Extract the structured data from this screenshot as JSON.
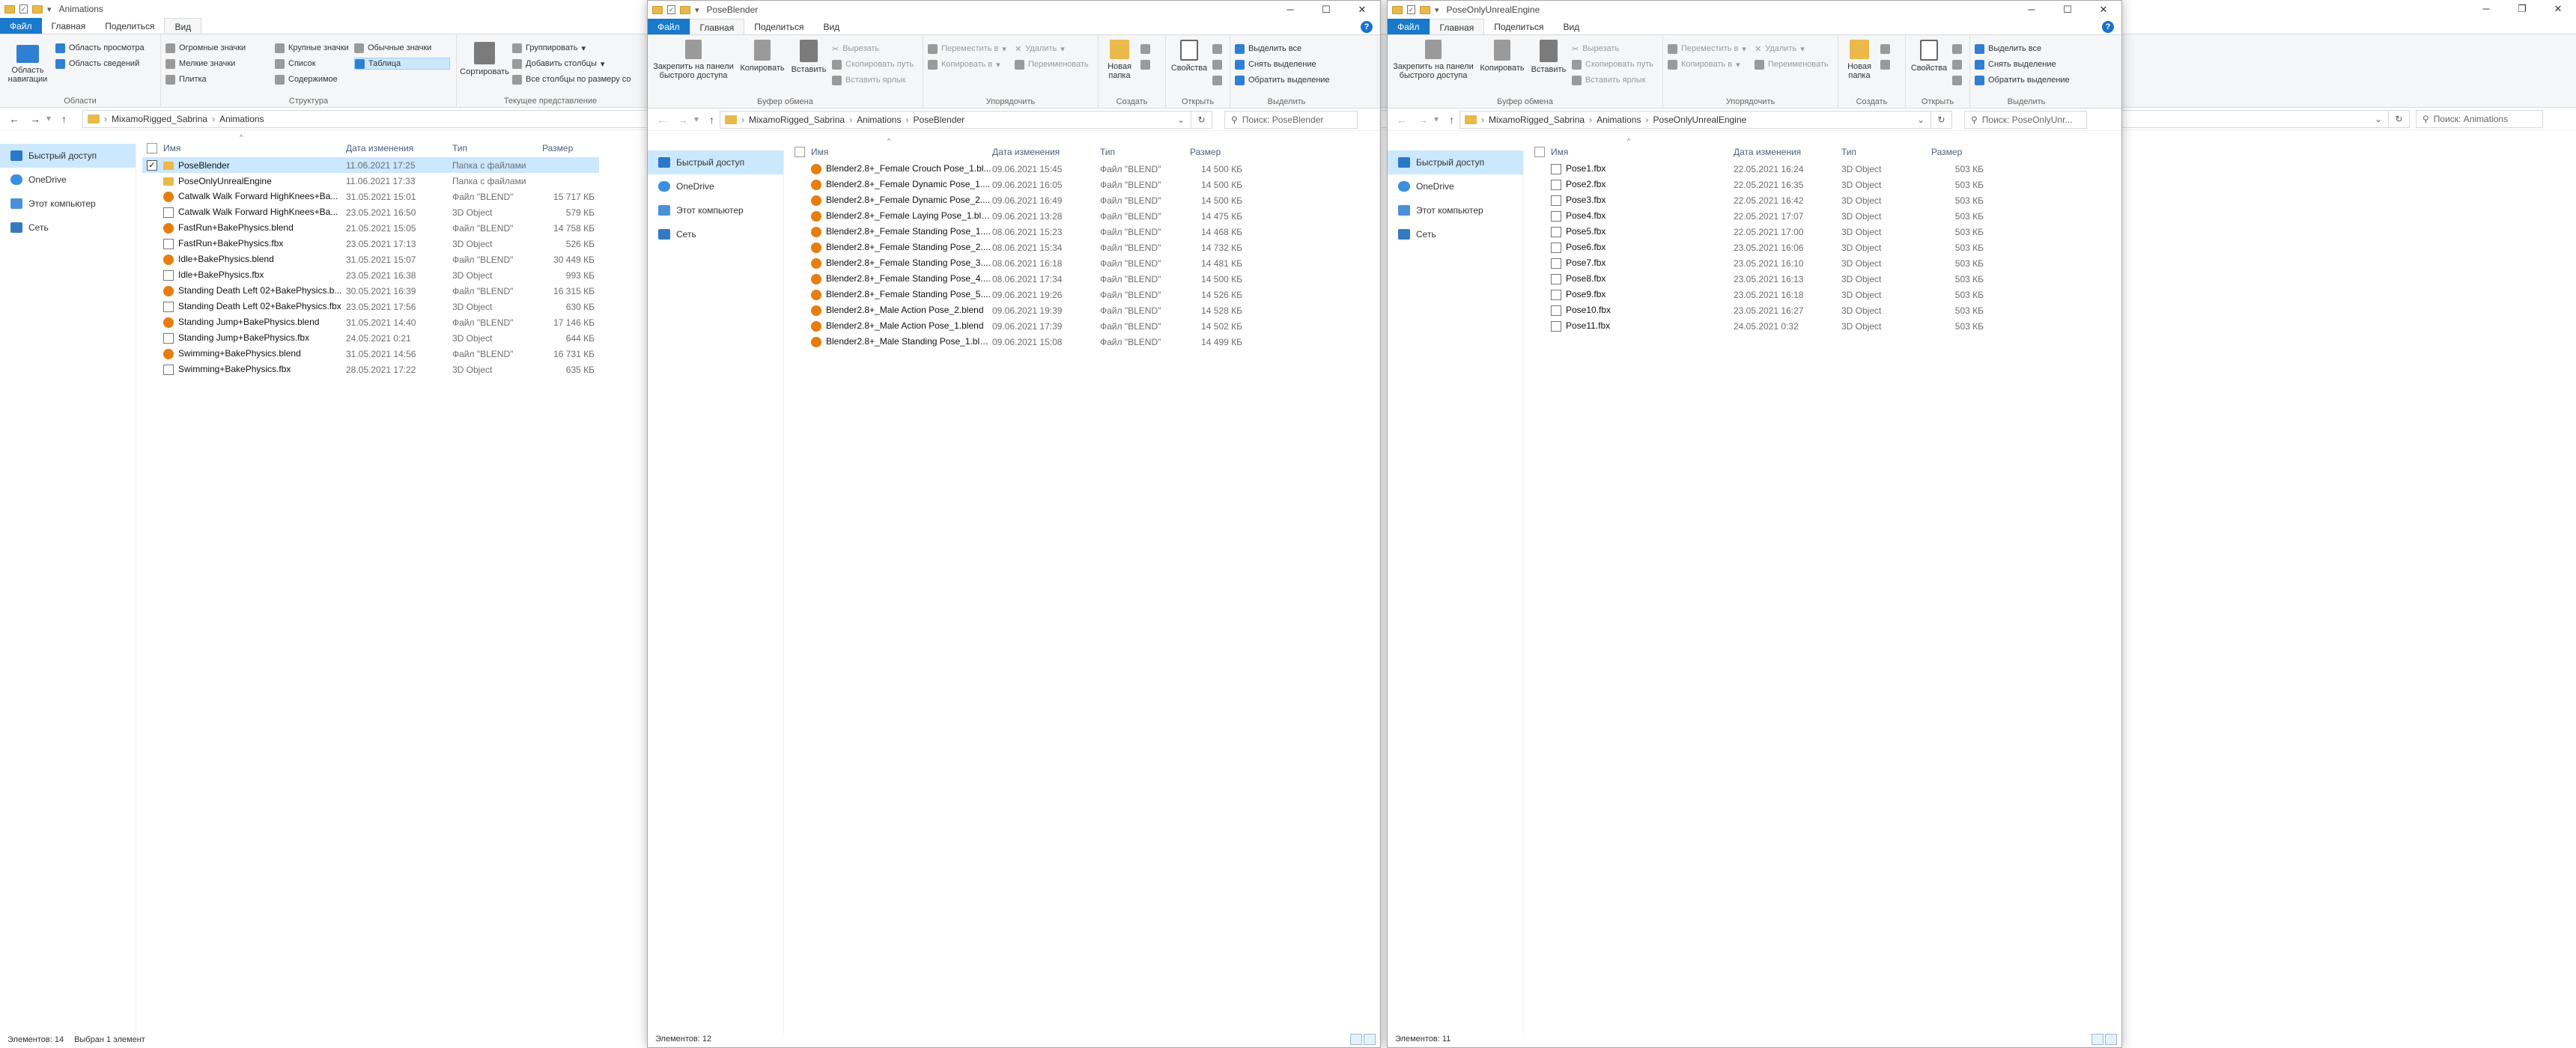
{
  "windows": {
    "animations": {
      "title": "Animations",
      "tabs": [
        "Файл",
        "Главная",
        "Поделиться",
        "Вид"
      ],
      "ribbon": {
        "panes": {
          "nav_pane": "Область навигации",
          "preview": "Область просмотра",
          "details": "Область сведений",
          "label": "Области"
        },
        "layout": {
          "huge": "Огромные значки",
          "large": "Крупные значки",
          "normal": "Обычные значки",
          "small": "Мелкие значки",
          "list": "Список",
          "table": "Таблица",
          "tile": "Плитка",
          "content": "Содержимое",
          "label": "Структура"
        },
        "current": {
          "sort": "Сортировать",
          "group": "Группировать",
          "add_cols": "Добавить столбцы",
          "fit_cols": "Все столбцы по размеру со",
          "label": "Текущее представление"
        }
      },
      "path": [
        "MixamoRigged_Sabrina",
        "Animations"
      ],
      "search_placeholder": "Поиск: Animations",
      "columns": {
        "name": "Имя",
        "date": "Дата изменения",
        "type": "Тип",
        "size": "Размер"
      },
      "files": [
        {
          "icon": "folder",
          "name": "PoseBlender",
          "date": "11.06.2021 17:25",
          "type": "Папка с файлами",
          "size": ""
        },
        {
          "icon": "folder",
          "name": "PoseOnlyUnrealEngine",
          "date": "11.06.2021 17:33",
          "type": "Папка с файлами",
          "size": ""
        },
        {
          "icon": "blend",
          "name": "Catwalk Walk Forward HighKnees+Ba...",
          "date": "31.05.2021 15:01",
          "type": "Файл \"BLEND\"",
          "size": "15 717 КБ"
        },
        {
          "icon": "fbx",
          "name": "Catwalk Walk Forward HighKnees+Ba...",
          "date": "23.05.2021 16:50",
          "type": "3D Object",
          "size": "579 КБ"
        },
        {
          "icon": "blend",
          "name": "FastRun+BakePhysics.blend",
          "date": "21.05.2021 15:05",
          "type": "Файл \"BLEND\"",
          "size": "14 758 КБ"
        },
        {
          "icon": "fbx",
          "name": "FastRun+BakePhysics.fbx",
          "date": "23.05.2021 17:13",
          "type": "3D Object",
          "size": "526 КБ"
        },
        {
          "icon": "blend",
          "name": "Idle+BakePhysics.blend",
          "date": "31.05.2021 15:07",
          "type": "Файл \"BLEND\"",
          "size": "30 449 КБ"
        },
        {
          "icon": "fbx",
          "name": "Idle+BakePhysics.fbx",
          "date": "23.05.2021 16:38",
          "type": "3D Object",
          "size": "993 КБ"
        },
        {
          "icon": "blend",
          "name": "Standing Death Left 02+BakePhysics.b...",
          "date": "30.05.2021 16:39",
          "type": "Файл \"BLEND\"",
          "size": "16 315 КБ"
        },
        {
          "icon": "fbx",
          "name": "Standing Death Left 02+BakePhysics.fbx",
          "date": "23.05.2021 17:56",
          "type": "3D Object",
          "size": "630 КБ"
        },
        {
          "icon": "blend",
          "name": "Standing Jump+BakePhysics.blend",
          "date": "31.05.2021 14:40",
          "type": "Файл \"BLEND\"",
          "size": "17 146 КБ"
        },
        {
          "icon": "fbx",
          "name": "Standing Jump+BakePhysics.fbx",
          "date": "24.05.2021 0:21",
          "type": "3D Object",
          "size": "644 КБ"
        },
        {
          "icon": "blend",
          "name": "Swimming+BakePhysics.blend",
          "date": "31.05.2021 14:56",
          "type": "Файл \"BLEND\"",
          "size": "16 731 КБ"
        },
        {
          "icon": "fbx",
          "name": "Swimming+BakePhysics.fbx",
          "date": "28.05.2021 17:22",
          "type": "3D Object",
          "size": "635 КБ"
        }
      ],
      "status": {
        "count": "Элементов: 14",
        "selected": "Выбран 1 элемент"
      }
    },
    "poseblender": {
      "title": "PoseBlender",
      "tabs": [
        "Файл",
        "Главная",
        "Поделиться",
        "Вид"
      ],
      "path": [
        "MixamoRigged_Sabrina",
        "Animations",
        "PoseBlender"
      ],
      "search_placeholder": "Поиск: PoseBlender",
      "columns": {
        "name": "Имя",
        "date": "Дата изменения",
        "type": "Тип",
        "size": "Размер"
      },
      "files": [
        {
          "name": "Blender2.8+_Female Crouch Pose_1.bl...",
          "date": "09.06.2021 15:45",
          "type": "Файл \"BLEND\"",
          "size": "14 500 КБ"
        },
        {
          "name": "Blender2.8+_Female Dynamic Pose_1....",
          "date": "09.06.2021 16:05",
          "type": "Файл \"BLEND\"",
          "size": "14 500 КБ"
        },
        {
          "name": "Blender2.8+_Female Dynamic Pose_2....",
          "date": "09.06.2021 16:49",
          "type": "Файл \"BLEND\"",
          "size": "14 500 КБ"
        },
        {
          "name": "Blender2.8+_Female Laying Pose_1.ble...",
          "date": "09.06.2021 13:28",
          "type": "Файл \"BLEND\"",
          "size": "14 475 КБ"
        },
        {
          "name": "Blender2.8+_Female Standing Pose_1....",
          "date": "08.06.2021 15:23",
          "type": "Файл \"BLEND\"",
          "size": "14 468 КБ"
        },
        {
          "name": "Blender2.8+_Female Standing Pose_2....",
          "date": "08.06.2021 15:34",
          "type": "Файл \"BLEND\"",
          "size": "14 732 КБ"
        },
        {
          "name": "Blender2.8+_Female Standing Pose_3....",
          "date": "08.06.2021 16:18",
          "type": "Файл \"BLEND\"",
          "size": "14 481 КБ"
        },
        {
          "name": "Blender2.8+_Female Standing Pose_4....",
          "date": "08.06.2021 17:34",
          "type": "Файл \"BLEND\"",
          "size": "14 500 КБ"
        },
        {
          "name": "Blender2.8+_Female Standing Pose_5....",
          "date": "09.06.2021 19:26",
          "type": "Файл \"BLEND\"",
          "size": "14 526 КБ"
        },
        {
          "name": "Blender2.8+_Male Action Pose_2.blend",
          "date": "09.06.2021 19:39",
          "type": "Файл \"BLEND\"",
          "size": "14 528 КБ"
        },
        {
          "name": "Blender2.8+_Male Action Pose_1.blend",
          "date": "09.06.2021 17:39",
          "type": "Файл \"BLEND\"",
          "size": "14 502 КБ"
        },
        {
          "name": "Blender2.8+_Male Standing Pose_1.blend",
          "date": "09.06.2021 15:08",
          "type": "Файл \"BLEND\"",
          "size": "14 499 КБ"
        }
      ],
      "status": {
        "count": "Элементов: 12"
      }
    },
    "poseonly": {
      "title": "PoseOnlyUnrealEngine",
      "tabs": [
        "Файл",
        "Главная",
        "Поделиться",
        "Вид"
      ],
      "path": [
        "MixamoRigged_Sabrina",
        "Animations",
        "PoseOnlyUnrealEngine"
      ],
      "search_placeholder": "Поиск: PoseOnlyUnr...",
      "columns": {
        "name": "Имя",
        "date": "Дата изменения",
        "type": "Тип",
        "size": "Размер"
      },
      "files": [
        {
          "name": "Pose1.fbx",
          "date": "22.05.2021 16:24",
          "type": "3D Object",
          "size": "503 КБ"
        },
        {
          "name": "Pose2.fbx",
          "date": "22.05.2021 16:35",
          "type": "3D Object",
          "size": "503 КБ"
        },
        {
          "name": "Pose3.fbx",
          "date": "22.05.2021 16:42",
          "type": "3D Object",
          "size": "503 КБ"
        },
        {
          "name": "Pose4.fbx",
          "date": "22.05.2021 17:07",
          "type": "3D Object",
          "size": "503 КБ"
        },
        {
          "name": "Pose5.fbx",
          "date": "22.05.2021 17:00",
          "type": "3D Object",
          "size": "503 КБ"
        },
        {
          "name": "Pose6.fbx",
          "date": "23.05.2021 16:06",
          "type": "3D Object",
          "size": "503 КБ"
        },
        {
          "name": "Pose7.fbx",
          "date": "23.05.2021 16:10",
          "type": "3D Object",
          "size": "503 КБ"
        },
        {
          "name": "Pose8.fbx",
          "date": "23.05.2021 16:13",
          "type": "3D Object",
          "size": "503 КБ"
        },
        {
          "name": "Pose9.fbx",
          "date": "23.05.2021 16:18",
          "type": "3D Object",
          "size": "503 КБ"
        },
        {
          "name": "Pose10.fbx",
          "date": "23.05.2021 16:27",
          "type": "3D Object",
          "size": "503 КБ"
        },
        {
          "name": "Pose11.fbx",
          "date": "24.05.2021 0:32",
          "type": "3D Object",
          "size": "503 КБ"
        }
      ],
      "status": {
        "count": "Элементов: 11"
      }
    }
  },
  "home_ribbon": {
    "pin": "Закрепить на панели быстрого доступа",
    "copy": "Копировать",
    "paste": "Вставить",
    "cut": "Вырезать",
    "copy_path": "Скопировать путь",
    "paste_shortcut": "Вставить ярлык",
    "clipboard_label": "Буфер обмена",
    "move_to": "Переместить в",
    "copy_to": "Копировать в",
    "delete": "Удалить",
    "rename": "Переименовать",
    "organize_label": "Упорядочить",
    "new_folder": "Новая папка",
    "create_label": "Создать",
    "properties": "Свойства",
    "open_label": "Открыть",
    "select_all": "Выделить все",
    "select_none": "Снять выделение",
    "invert": "Обратить выделение",
    "select_label": "Выделить"
  },
  "nav_items": [
    "Быстрый доступ",
    "OneDrive",
    "Этот компьютер",
    "Сеть"
  ],
  "colors": {
    "accent": "#1979ca",
    "selection": "#cce8ff",
    "folder": "#e9b94a",
    "blend": "#e87d0d"
  }
}
